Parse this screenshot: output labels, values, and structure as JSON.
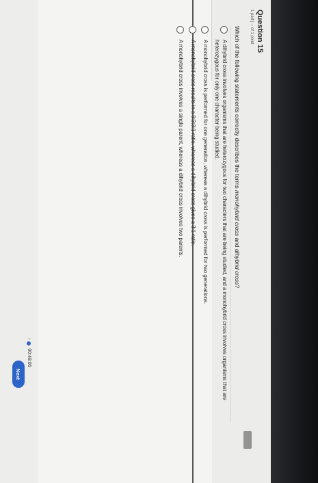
{
  "question": {
    "title": "Question 15",
    "meta": "1 part  |  -- of 1 point"
  },
  "prompt": {
    "before": "Which of the following statements correctly describes the terms ",
    "term1": "monohybrid cross",
    "middle": " and ",
    "term2": "dihybrid cross",
    "after": "?"
  },
  "options": [
    "A dihybrid cross involves organisms that are heterozygous for two characters that are being studied, and a monohybrid cross involves organisms that are heterozygous for only one character being studied.",
    "A monohybrid cross is performed for one generation, whereas a dihybrid cross is performed for two generations.",
    "A monohybrid cross results in a 9:3:3:1 ratio, whereas a dihybrid cross gives a 3:1 ratio.",
    "A monohybrid cross involves a single parent, whereas a dihybrid cross involves two parents."
  ],
  "footer": {
    "timer": "00:48:06",
    "next_label": "Next"
  }
}
